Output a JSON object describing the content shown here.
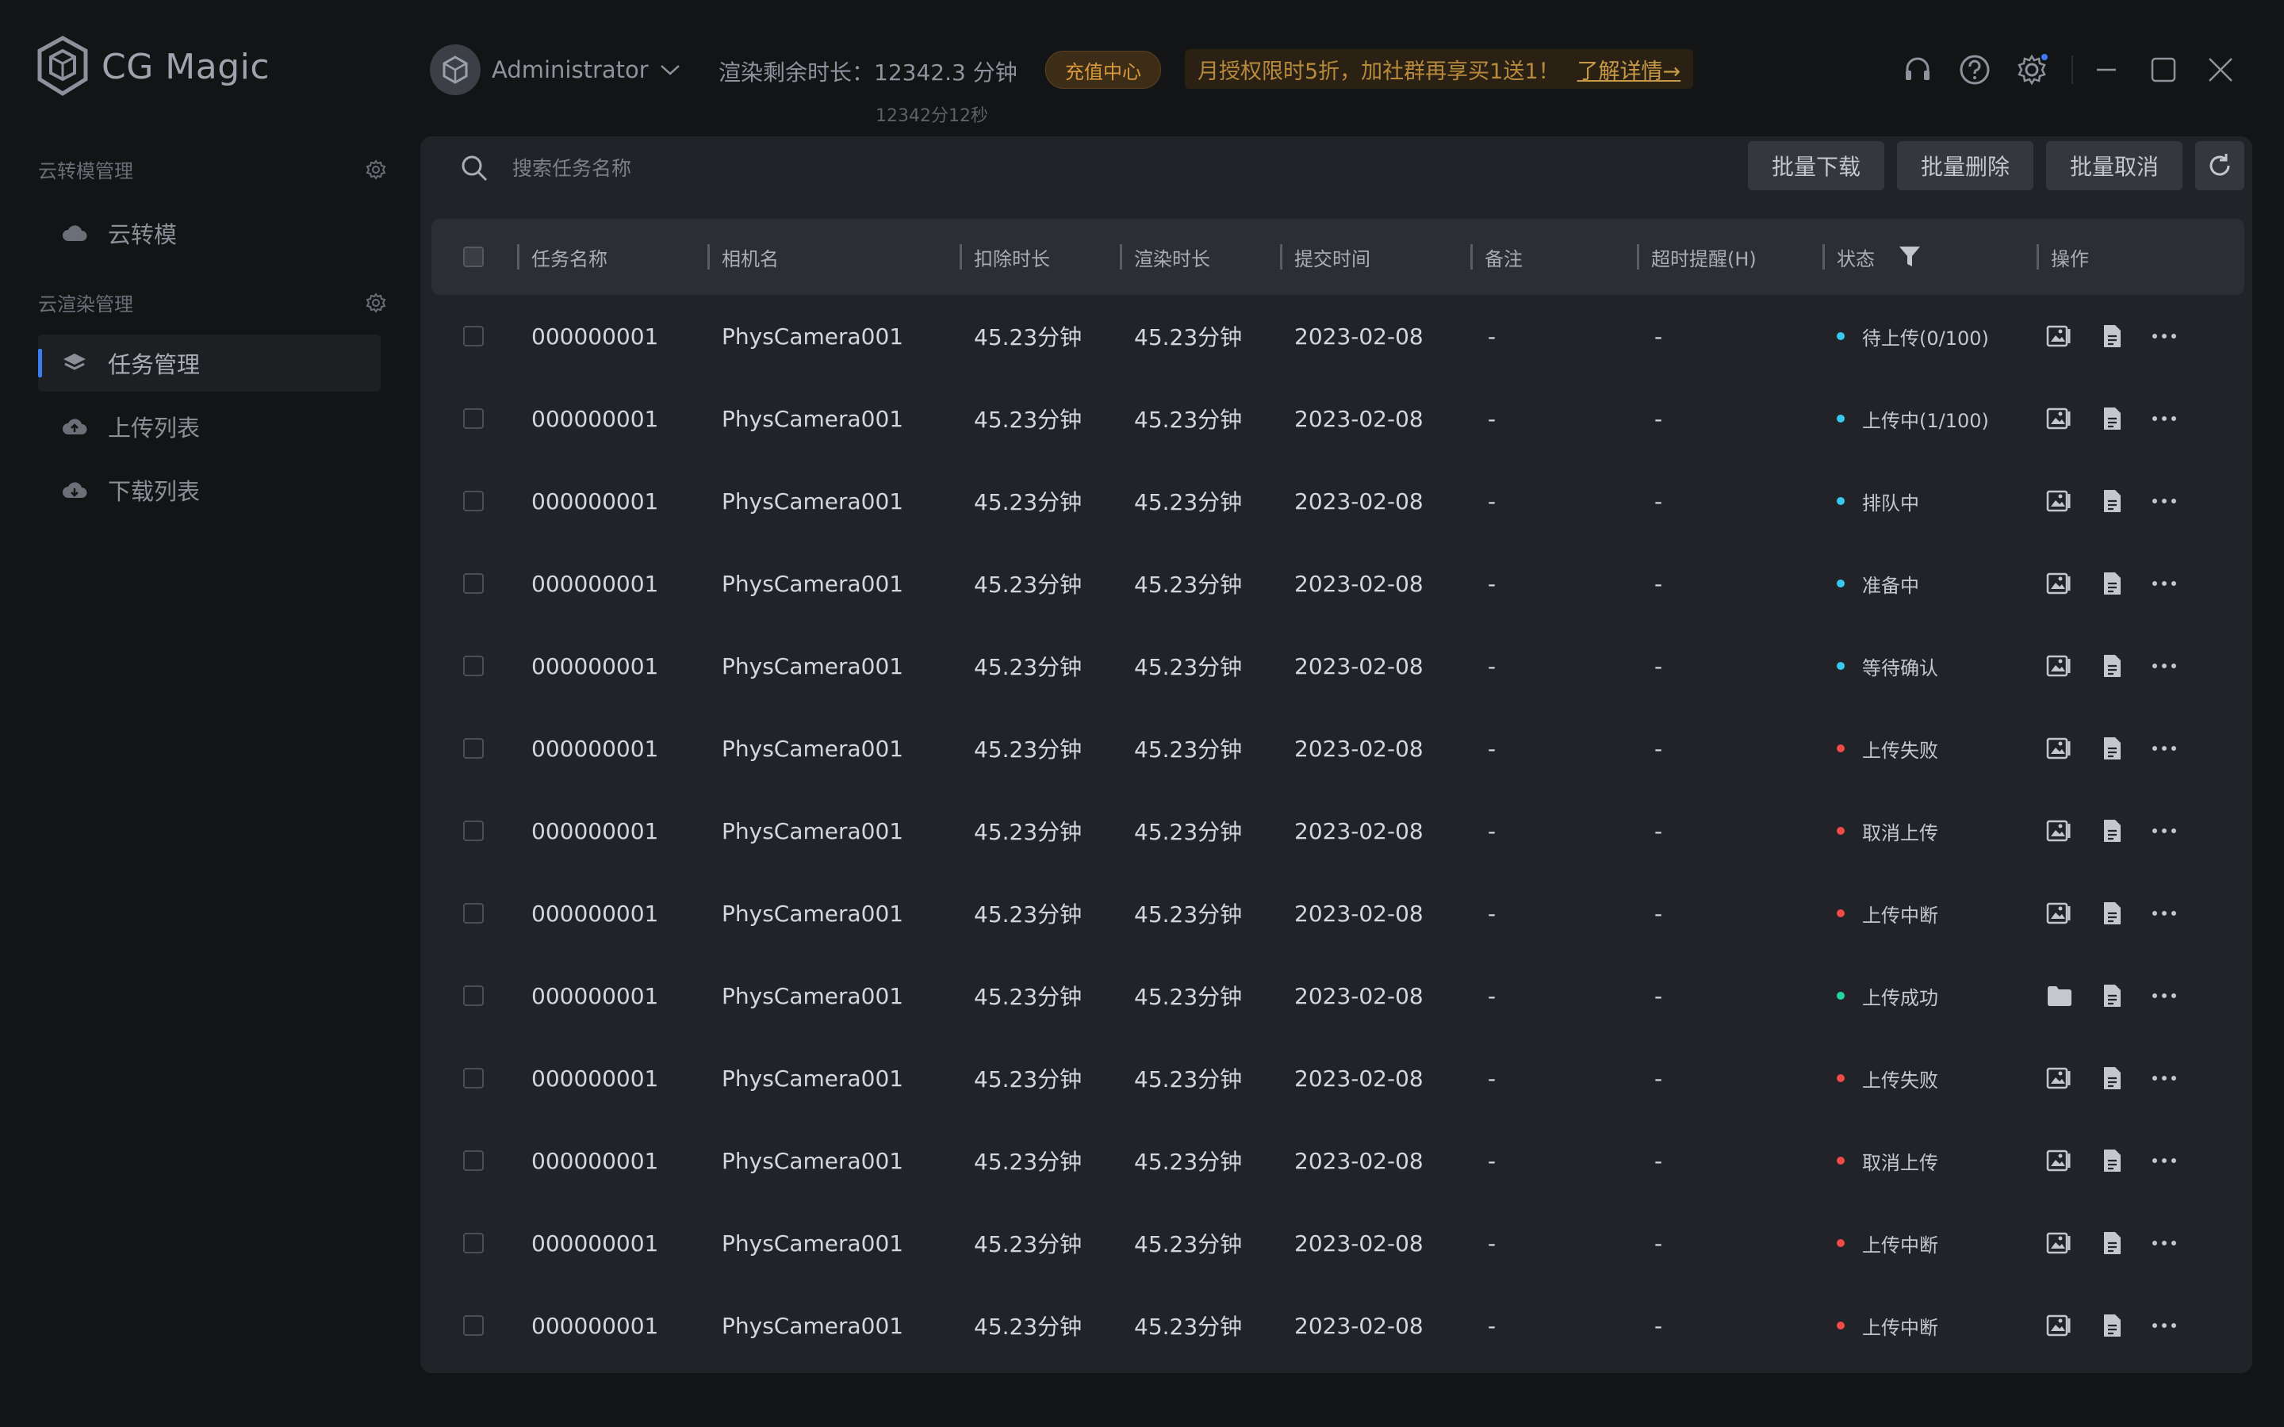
{
  "app": {
    "logo_text": "CG Magic"
  },
  "user": {
    "name": "Administrator"
  },
  "render": {
    "remaining_label": "渲染剩余时长：12342.3 分钟",
    "remaining_sub": "12342分12秒",
    "recharge_label": "充值中心"
  },
  "promo": {
    "text": "月授权限时5折，加社群再享买1送1！",
    "link": "了解详情→"
  },
  "colors": {
    "accent": "#3b7df1",
    "status_blue": "#38c7f0",
    "status_red": "#ef4a4a",
    "status_green": "#23d3a0",
    "recharge": "#d89a3d"
  },
  "sidebar": {
    "section1": {
      "title": "云转模管理"
    },
    "item_cloud": {
      "label": "云转模",
      "icon": "cloud-icon"
    },
    "section2": {
      "title": "云渲染管理"
    },
    "item_tasks": {
      "label": "任务管理",
      "icon": "layers-icon"
    },
    "item_upload": {
      "label": "上传列表",
      "icon": "cloud-upload-icon"
    },
    "item_download": {
      "label": "下载列表",
      "icon": "cloud-download-icon"
    }
  },
  "search": {
    "placeholder": "搜索任务名称"
  },
  "toolbar": {
    "batch_download": "批量下载",
    "batch_delete": "批量删除",
    "batch_cancel": "批量取消"
  },
  "table": {
    "columns": {
      "name": "任务名称",
      "camera": "相机名",
      "deduct": "扣除时长",
      "render": "渲染时长",
      "submit": "提交时间",
      "note": "备注",
      "timeout": "超时提醒(H)",
      "status": "状态",
      "actions": "操作"
    },
    "rows": [
      {
        "name": "000000001",
        "camera": "PhysCamera001",
        "deduct": "45.23分钟",
        "render": "45.23分钟",
        "submit": "2023-02-08",
        "note": "-",
        "timeout": "-",
        "status": "待上传(0/100)",
        "status_color": "#38c7f0",
        "first_action": "preview-icon"
      },
      {
        "name": "000000001",
        "camera": "PhysCamera001",
        "deduct": "45.23分钟",
        "render": "45.23分钟",
        "submit": "2023-02-08",
        "note": "-",
        "timeout": "-",
        "status": "上传中(1/100)",
        "status_color": "#38c7f0",
        "first_action": "preview-icon"
      },
      {
        "name": "000000001",
        "camera": "PhysCamera001",
        "deduct": "45.23分钟",
        "render": "45.23分钟",
        "submit": "2023-02-08",
        "note": "-",
        "timeout": "-",
        "status": "排队中",
        "status_color": "#38c7f0",
        "first_action": "preview-icon"
      },
      {
        "name": "000000001",
        "camera": "PhysCamera001",
        "deduct": "45.23分钟",
        "render": "45.23分钟",
        "submit": "2023-02-08",
        "note": "-",
        "timeout": "-",
        "status": "准备中",
        "status_color": "#38c7f0",
        "first_action": "preview-icon"
      },
      {
        "name": "000000001",
        "camera": "PhysCamera001",
        "deduct": "45.23分钟",
        "render": "45.23分钟",
        "submit": "2023-02-08",
        "note": "-",
        "timeout": "-",
        "status": "等待确认",
        "status_color": "#38c7f0",
        "first_action": "preview-icon"
      },
      {
        "name": "000000001",
        "camera": "PhysCamera001",
        "deduct": "45.23分钟",
        "render": "45.23分钟",
        "submit": "2023-02-08",
        "note": "-",
        "timeout": "-",
        "status": "上传失败",
        "status_color": "#ef4a4a",
        "first_action": "preview-icon"
      },
      {
        "name": "000000001",
        "camera": "PhysCamera001",
        "deduct": "45.23分钟",
        "render": "45.23分钟",
        "submit": "2023-02-08",
        "note": "-",
        "timeout": "-",
        "status": "取消上传",
        "status_color": "#ef4a4a",
        "first_action": "preview-icon"
      },
      {
        "name": "000000001",
        "camera": "PhysCamera001",
        "deduct": "45.23分钟",
        "render": "45.23分钟",
        "submit": "2023-02-08",
        "note": "-",
        "timeout": "-",
        "status": "上传中断",
        "status_color": "#ef4a4a",
        "first_action": "preview-icon"
      },
      {
        "name": "000000001",
        "camera": "PhysCamera001",
        "deduct": "45.23分钟",
        "render": "45.23分钟",
        "submit": "2023-02-08",
        "note": "-",
        "timeout": "-",
        "status": "上传成功",
        "status_color": "#23d3a0",
        "first_action": "folder-icon"
      },
      {
        "name": "000000001",
        "camera": "PhysCamera001",
        "deduct": "45.23分钟",
        "render": "45.23分钟",
        "submit": "2023-02-08",
        "note": "-",
        "timeout": "-",
        "status": "上传失败",
        "status_color": "#ef4a4a",
        "first_action": "preview-icon"
      },
      {
        "name": "000000001",
        "camera": "PhysCamera001",
        "deduct": "45.23分钟",
        "render": "45.23分钟",
        "submit": "2023-02-08",
        "note": "-",
        "timeout": "-",
        "status": "取消上传",
        "status_color": "#ef4a4a",
        "first_action": "preview-icon"
      },
      {
        "name": "000000001",
        "camera": "PhysCamera001",
        "deduct": "45.23分钟",
        "render": "45.23分钟",
        "submit": "2023-02-08",
        "note": "-",
        "timeout": "-",
        "status": "上传中断",
        "status_color": "#ef4a4a",
        "first_action": "preview-icon"
      },
      {
        "name": "000000001",
        "camera": "PhysCamera001",
        "deduct": "45.23分钟",
        "render": "45.23分钟",
        "submit": "2023-02-08",
        "note": "-",
        "timeout": "-",
        "status": "上传中断",
        "status_color": "#ef4a4a",
        "first_action": "preview-icon"
      }
    ]
  }
}
